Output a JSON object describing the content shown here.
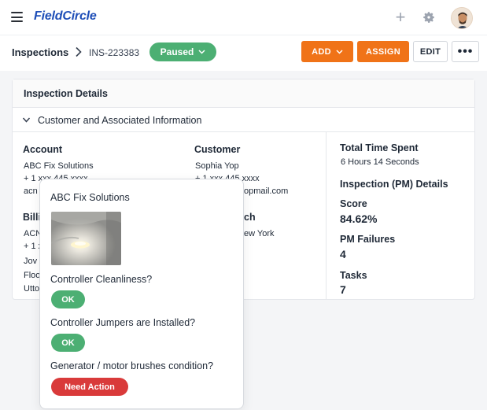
{
  "app": {
    "name": "FieldCircle"
  },
  "breadcrumb": {
    "root": "Inspections",
    "id": "INS-223383"
  },
  "status": {
    "label": "Paused",
    "color": "#4caf73"
  },
  "toolbar": {
    "add_label": "ADD",
    "assign_label": "ASSIGN",
    "edit_label": "EDIT",
    "more_label": "•••"
  },
  "colors": {
    "accent": "#f07318",
    "brand": "#1f4fb8",
    "ok": "#4caf73",
    "danger": "#d93a3a"
  },
  "icons": [
    "menu-icon",
    "plus-icon",
    "gear-icon",
    "chevron-right-icon",
    "chevron-down-icon"
  ],
  "card": {
    "title": "Inspection Details",
    "section_title": "Customer and Associated Information"
  },
  "account": {
    "label": "Account",
    "name": "ABC Fix Solutions",
    "phone": "+ 1 xxx 445 xxxx",
    "email_partial": "acn"
  },
  "customer": {
    "label": "Customer",
    "name": "Sophia Yop",
    "phone": "+ 1 xxx 445 xxxx",
    "email_partial": "opmail.com"
  },
  "billing": {
    "label_partial": "Billi",
    "line1": "ACN",
    "line2": "+ 1 x",
    "line3": "Jov",
    "line4": "Floo",
    "line5": "Utto"
  },
  "branch": {
    "label_partial": "ch",
    "value_partial": "ew York"
  },
  "summary": {
    "time_label": "Total Time Spent",
    "time_value": "6 Hours 14 Seconds",
    "pm_title": "Inspection (PM) Details",
    "score_label": "Score",
    "score_value": "84.62%",
    "failures_label": "PM Failures",
    "failures_value": "4",
    "tasks_label": "Tasks",
    "tasks_value": "7"
  },
  "popover": {
    "title": "ABC Fix Solutions",
    "items": [
      {
        "question": "Controller Cleanliness?",
        "result": "OK"
      },
      {
        "question": "Controller Jumpers are Installed?",
        "result": "OK"
      },
      {
        "question": "Generator / motor brushes condition?",
        "result": "Need Action"
      }
    ]
  }
}
